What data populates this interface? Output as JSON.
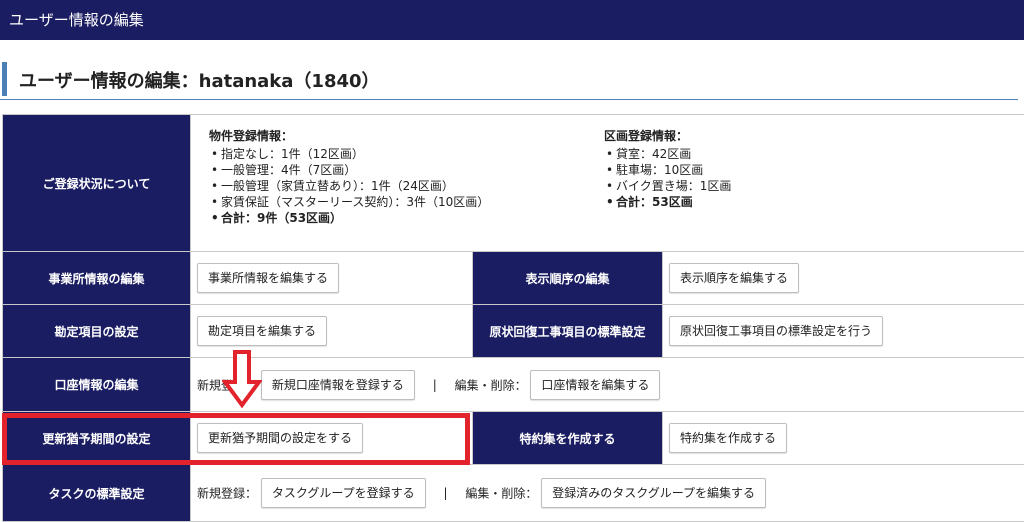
{
  "header": {
    "title": "ユーザー情報の編集"
  },
  "page": {
    "title": "ユーザー情報の編集：hatanaka（1840）"
  },
  "rows": {
    "registration": {
      "label": "ご登録状況について",
      "property": {
        "heading": "物件登録情報：",
        "items": [
          "指定なし：1件（12区画）",
          "一般管理：4件（7区画）",
          "一般管理（家賃立替あり）：1件（24区画）",
          "家賃保証（マスターリース契約）：3件（10区画）"
        ],
        "total": "合計：9件（53区画）"
      },
      "section": {
        "heading": "区画登録情報：",
        "items": [
          "貸室：42区画",
          "駐車場：10区画",
          "バイク置き場：1区画"
        ],
        "total": "合計：53区画"
      }
    },
    "office": {
      "label": "事業所情報の編集",
      "button": "事業所情報を編集する"
    },
    "display_order": {
      "label": "表示順序の編集",
      "button": "表示順序を編集する"
    },
    "accounts": {
      "label": "勘定項目の設定",
      "button": "勘定項目を編集する"
    },
    "restoration": {
      "label": "原状回復工事項目の標準設定",
      "button": "原状回復工事項目の標準設定を行う"
    },
    "bank": {
      "label": "口座情報の編集",
      "new_label": "新規登録：",
      "new_button": "新規口座情報を登録する",
      "separator": "|",
      "edit_label": "編集・削除：",
      "edit_button": "口座情報を編集する"
    },
    "renewal": {
      "label": "更新猶予期間の設定",
      "button": "更新猶予期間の設定をする"
    },
    "special": {
      "label": "特約集を作成する",
      "button": "特約集を作成する"
    },
    "task": {
      "label": "タスクの標準設定",
      "new_label": "新規登録：",
      "new_button": "タスクグループを登録する",
      "separator": "|",
      "edit_label": "編集・削除：",
      "edit_button": "登録済みのタスクグループを編集する"
    }
  },
  "colors": {
    "header_bg": "#1b1d63",
    "accent": "#4b7fb5",
    "highlight": "#e3232b"
  }
}
